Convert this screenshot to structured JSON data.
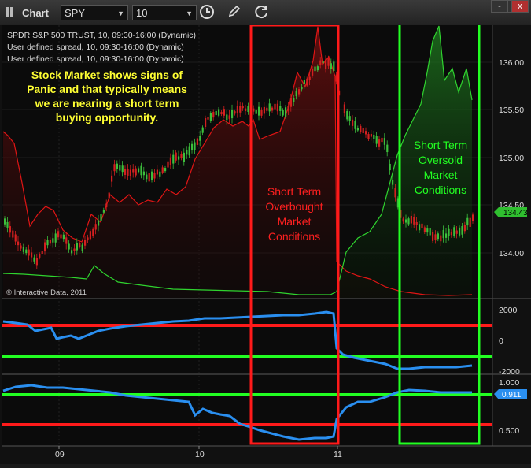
{
  "toolbar": {
    "title": "Chart",
    "symbol": "SPY",
    "period": "10",
    "minimize_label": "-",
    "maximize_label": "□",
    "close_label": "x"
  },
  "legend": [
    "SPDR S&P 500 TRUST, 10, 09:30-16:00 (Dynamic)",
    "User defined spread, 10, 09:30-16:00 (Dynamic)",
    "User defined spread, 10, 09:30-16:00 (Dynamic)"
  ],
  "copyright": "© Interactive Data, 2011",
  "annotations": {
    "panic": [
      "Stock Market shows signs of",
      "Panic and that typically  means",
      "we are nearing a short term",
      "buying opportunity."
    ],
    "overbought": [
      "Short Term",
      "Overbought",
      "Market",
      "Conditions"
    ],
    "oversold": [
      "Short Term",
      "Oversold",
      "Market",
      "Conditions"
    ]
  },
  "price_axis": {
    "ticks": [
      "136.00",
      "135.50",
      "135.00",
      "134.50",
      "134.00"
    ],
    "current": "134.43"
  },
  "spread_axis": {
    "ticks": [
      "2000",
      "0",
      "-2000"
    ]
  },
  "ratio_axis": {
    "ticks": [
      "1.000",
      "0.500"
    ],
    "current": "0.911"
  },
  "time_axis": {
    "ticks": [
      "09",
      "10",
      "11"
    ]
  },
  "colors": {
    "up": "#3cbf3c",
    "down": "#d42020",
    "spread": "#2a8ff0",
    "red_zone": "#ff1a1a",
    "green_zone": "#22ff22",
    "annotation_yellow": "#ffff33"
  }
}
